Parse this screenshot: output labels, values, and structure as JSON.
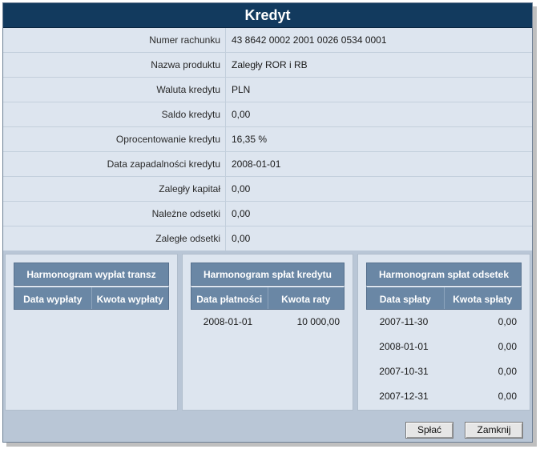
{
  "window": {
    "title": "Kredyt"
  },
  "details": [
    {
      "label": "Numer rachunku",
      "value": "43 8642 0002 2001 0026 0534 0001"
    },
    {
      "label": "Nazwa produktu",
      "value": "Zaległy ROR i RB"
    },
    {
      "label": "Waluta kredytu",
      "value": "PLN"
    },
    {
      "label": "Saldo kredytu",
      "value": "0,00"
    },
    {
      "label": "Oprocentowanie kredytu",
      "value": "16,35 %"
    },
    {
      "label": "Data zapadalności kredytu",
      "value": "2008-01-01"
    },
    {
      "label": "Zaległy kapitał",
      "value": "0,00"
    },
    {
      "label": "Należne odsetki",
      "value": "0,00"
    },
    {
      "label": "Zaległe odsetki",
      "value": "0,00"
    }
  ],
  "panels": [
    {
      "title": "Harmonogram wypłat transz",
      "col1": "Data wypłaty",
      "col2": "Kwota wypłaty",
      "rows": []
    },
    {
      "title": "Harmonogram spłat kredytu",
      "col1": "Data płatności",
      "col2": "Kwota raty",
      "rows": [
        {
          "date": "2008-01-01",
          "amount": "10 000,00"
        }
      ]
    },
    {
      "title": "Harmonogram spłat odsetek",
      "col1": "Data spłaty",
      "col2": "Kwota spłaty",
      "rows": [
        {
          "date": "2007-11-30",
          "amount": "0,00"
        },
        {
          "date": "2008-01-01",
          "amount": "0,00"
        },
        {
          "date": "2007-10-31",
          "amount": "0,00"
        },
        {
          "date": "2007-12-31",
          "amount": "0,00"
        }
      ]
    }
  ],
  "buttons": {
    "pay": "Spłać",
    "close": "Zamknij"
  }
}
